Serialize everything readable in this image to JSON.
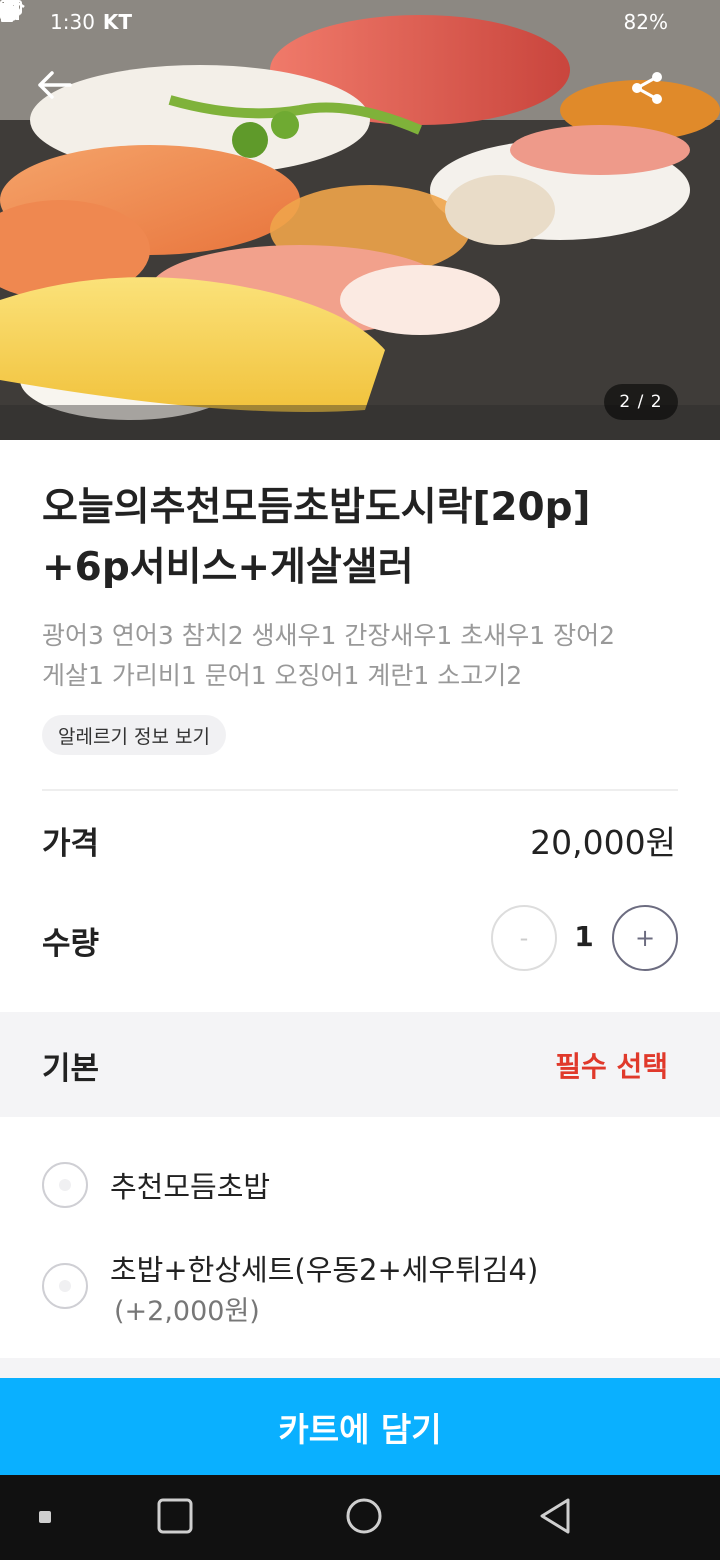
{
  "status_bar": {
    "time": "1:30",
    "carrier": "KT",
    "battery": "82%",
    "icons": [
      "alarm-icon",
      "wifi-icon",
      "signal-icon",
      "battery-icon"
    ]
  },
  "hero": {
    "page_indicator": "2 / 2",
    "icons": [
      "back-arrow-icon",
      "share-icon"
    ]
  },
  "product": {
    "title_line1": "오늘의추천모듬초밥도시락[20p]",
    "title_line2": "+6p서비스+게살샐러",
    "desc_line1": "광어3 연어3 참치2 생새우1 간장새우1 초새우1 장어2",
    "desc_line2": "게살1 가리비1 문어1 오징어1 계란1 소고기2",
    "allergy_label": "알레르기 정보 보기"
  },
  "price": {
    "label": "가격",
    "value": "20,000원"
  },
  "quantity": {
    "label": "수량",
    "minus": "-",
    "value": "1",
    "plus": "+"
  },
  "options": {
    "section_title": "기본",
    "required": "필수 선택",
    "items": [
      {
        "label": "추천모듬초밥",
        "price": ""
      },
      {
        "label": "초밥+한상세트(우동2+세우튀김4)",
        "price": "(+2,000원)"
      }
    ]
  },
  "cart_button": "카트에 담기",
  "colors": {
    "accent": "#0ab0ff",
    "required_red": "#e0392b",
    "section_bg": "#f4f4f6"
  }
}
